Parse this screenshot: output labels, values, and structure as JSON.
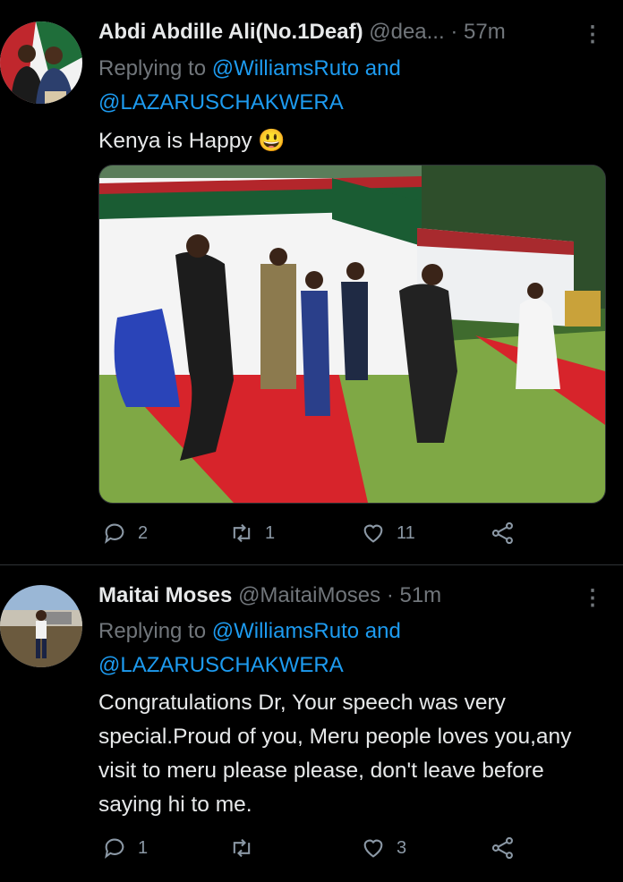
{
  "tweets": [
    {
      "name": "Abdi Abdille Ali(No.1Deaf)",
      "handle": "@dea...",
      "dot": "·",
      "time": "57m",
      "replying_prefix": "Replying to",
      "mention1": "@WilliamsRuto and",
      "mention2": "@LAZARUSCHAKWERA",
      "text": "Kenya is Happy",
      "emoji": "😃",
      "reply_count": "2",
      "retweet_count": "1",
      "like_count": "11"
    },
    {
      "name": "Maitai Moses",
      "handle": "@MaitaiMoses",
      "dot": "·",
      "time": "51m",
      "replying_prefix": "Replying to",
      "mention1": "@WilliamsRuto and",
      "mention2": "@LAZARUSCHAKWERA",
      "text": "Congratulations Dr, Your speech was very special.Proud of you, Meru people loves you,any visit to meru please please, don't leave before saying hi to me.",
      "reply_count": "1",
      "retweet_count": "",
      "like_count": "3"
    }
  ],
  "icons": {
    "reply": "reply-icon",
    "retweet": "retweet-icon",
    "like": "heart-icon",
    "share": "share-icon",
    "more": "more-icon"
  },
  "colors": {
    "background": "#000000",
    "text": "#e7e9ea",
    "secondary": "#71767b",
    "link": "#1d9bf0"
  }
}
